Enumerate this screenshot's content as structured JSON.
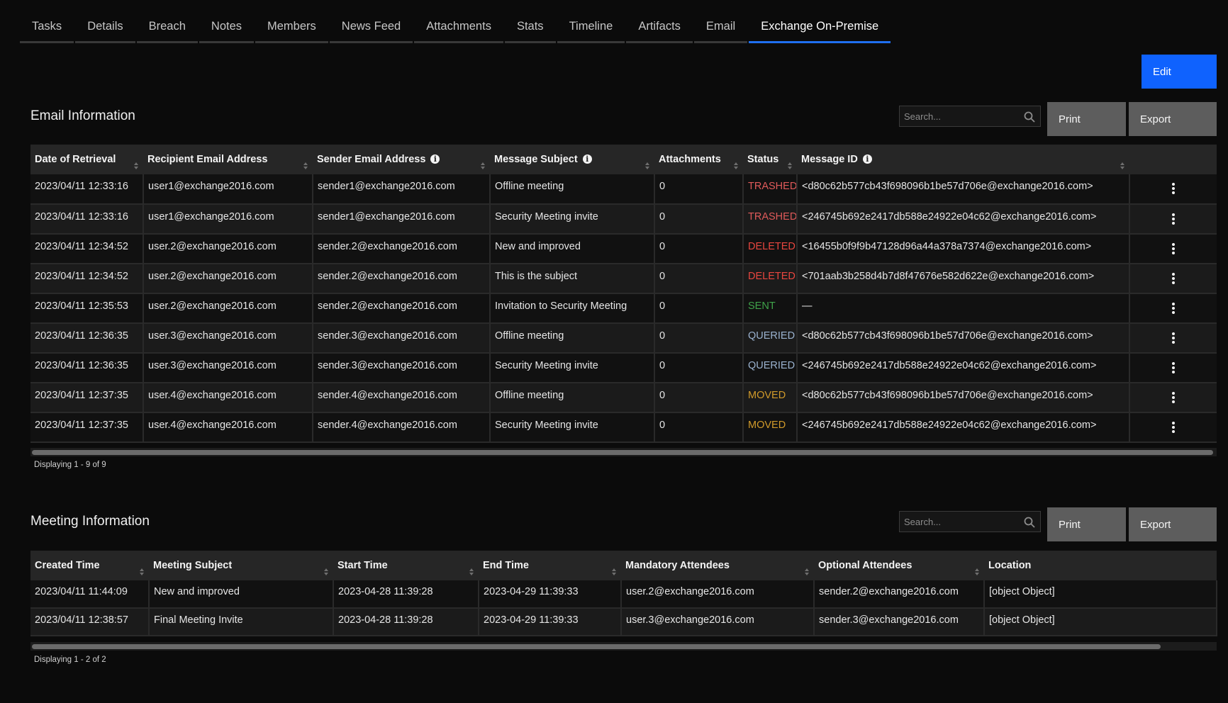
{
  "tabs": [
    "Tasks",
    "Details",
    "Breach",
    "Notes",
    "Members",
    "News Feed",
    "Attachments",
    "Stats",
    "Timeline",
    "Artifacts",
    "Email",
    "Exchange On-Premise"
  ],
  "active_tab": "Exchange On-Premise",
  "edit_label": "Edit",
  "email_section": {
    "title": "Email Information",
    "search_placeholder": "Search...",
    "print_label": "Print",
    "export_label": "Export",
    "columns": [
      "Date of Retrieval",
      "Recipient Email Address",
      "Sender Email Address",
      "Message Subject",
      "Attachments",
      "Status",
      "Message ID"
    ],
    "rows": [
      [
        "2023/04/11 12:33:16",
        "user1@exchange2016.com",
        "sender1@exchange2016.com",
        "Offline meeting",
        "0",
        "TRASHED",
        "<d80c62b577cb43f698096b1be57d706e@exchange2016.com>"
      ],
      [
        "2023/04/11 12:33:16",
        "user1@exchange2016.com",
        "sender1@exchange2016.com",
        "Security Meeting invite",
        "0",
        "TRASHED",
        "<246745b692e2417db588e24922e04c62@exchange2016.com>"
      ],
      [
        "2023/04/11 12:34:52",
        "user.2@exchange2016.com",
        "sender.2@exchange2016.com",
        "New and improved",
        "0",
        "DELETED",
        "<16455b0f9f9b47128d96a44a378a7374@exchange2016.com>"
      ],
      [
        "2023/04/11 12:34:52",
        "user.2@exchange2016.com",
        "sender.2@exchange2016.com",
        "This is the subject",
        "0",
        "DELETED",
        "<701aab3b258d4b7d8f47676e582d622e@exchange2016.com>"
      ],
      [
        "2023/04/11 12:35:53",
        "user.2@exchange2016.com",
        "sender.2@exchange2016.com",
        "Invitation to Security Meeting",
        "0",
        "SENT",
        "—"
      ],
      [
        "2023/04/11 12:36:35",
        "user.3@exchange2016.com",
        "sender.3@exchange2016.com",
        "Offline meeting",
        "0",
        "QUERIED",
        "<d80c62b577cb43f698096b1be57d706e@exchange2016.com>"
      ],
      [
        "2023/04/11 12:36:35",
        "user.3@exchange2016.com",
        "sender.3@exchange2016.com",
        "Security Meeting invite",
        "0",
        "QUERIED",
        "<246745b692e2417db588e24922e04c62@exchange2016.com>"
      ],
      [
        "2023/04/11 12:37:35",
        "user.4@exchange2016.com",
        "sender.4@exchange2016.com",
        "Offline meeting",
        "0",
        "MOVED",
        "<d80c62b577cb43f698096b1be57d706e@exchange2016.com>"
      ],
      [
        "2023/04/11 12:37:35",
        "user.4@exchange2016.com",
        "sender.4@exchange2016.com",
        "Security Meeting invite",
        "0",
        "MOVED",
        "<246745b692e2417db588e24922e04c62@exchange2016.com>"
      ]
    ],
    "footer": "Displaying 1 - 9 of 9"
  },
  "meeting_section": {
    "title": "Meeting Information",
    "search_placeholder": "Search...",
    "print_label": "Print",
    "export_label": "Export",
    "columns": [
      "Created Time",
      "Meeting Subject",
      "Start Time",
      "End Time",
      "Mandatory Attendees",
      "Optional Attendees",
      "Location"
    ],
    "rows": [
      [
        "2023/04/11 11:44:09",
        "New and improved",
        "2023-04-28 11:39:28",
        "2023-04-29 11:39:33",
        "user.2@exchange2016.com",
        "sender.2@exchange2016.com",
        "[object Object]"
      ],
      [
        "2023/04/11 12:38:57",
        "Final Meeting Invite",
        "2023-04-28 11:39:28",
        "2023-04-29 11:39:33",
        "user.3@exchange2016.com",
        "sender.3@exchange2016.com",
        "[object Object]"
      ]
    ],
    "footer": "Displaying 1 - 2 of 2"
  },
  "status_colors": {
    "TRASHED": "#e05a5a",
    "DELETED": "#e9463f",
    "SENT": "#3fa34a",
    "QUERIED": "#9ab2cf",
    "MOVED": "#d19a2a"
  },
  "accent": "#0f62fe",
  "icons": [
    "search-icon",
    "sort-icon",
    "info-icon",
    "overflow-menu-icon"
  ]
}
